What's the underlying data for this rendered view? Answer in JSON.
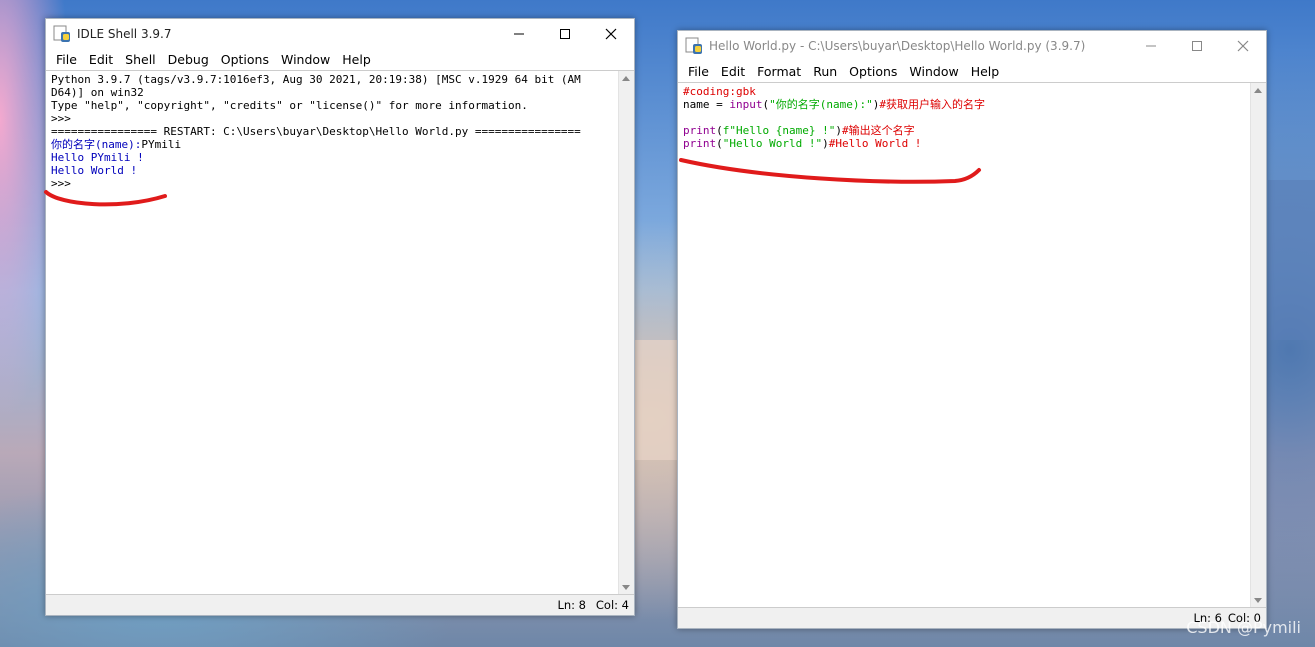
{
  "shell": {
    "title": "IDLE Shell 3.9.7",
    "menu": [
      "File",
      "Edit",
      "Shell",
      "Debug",
      "Options",
      "Window",
      "Help"
    ],
    "lines": [
      "Python 3.9.7 (tags/v3.9.7:1016ef3, Aug 30 2021, 20:19:38) [MSC v.1929 64 bit (AM",
      "D64)] on win32",
      "Type \"help\", \"copyright\", \"credits\" or \"license()\" for more information.",
      ">>>",
      "================ RESTART: C:\\Users\\buyar\\Desktop\\Hello World.py ================"
    ],
    "prompt_label": "你的名字(name):",
    "prompt_input": "PYmili",
    "output": [
      "Hello PYmili !",
      "Hello World !"
    ],
    "final_prompt": ">>>",
    "status_ln": "Ln: 8",
    "status_col": "Col: 4"
  },
  "editor": {
    "title": "Hello World.py - C:\\Users\\buyar\\Desktop\\Hello World.py (3.9.7)",
    "menu": [
      "File",
      "Edit",
      "Format",
      "Run",
      "Options",
      "Window",
      "Help"
    ],
    "line1": "#coding:gbk",
    "line2": {
      "a": "name = ",
      "b": "input",
      "c": "(",
      "d": "\"你的名字(name):\"",
      "e": ")",
      "f": "#获取用户输入的名字"
    },
    "line4": {
      "a": "print",
      "b": "(",
      "c": "f\"Hello {name} !\"",
      "d": ")",
      "e": "#输出这个名字"
    },
    "line5": {
      "a": "print",
      "b": "(",
      "c": "\"Hello World !\"",
      "d": ")",
      "e": "#Hello World !"
    },
    "status_ln": "Ln: 6",
    "status_col": "Col: 0"
  },
  "watermark": "CSDN @Pymili",
  "colors": {
    "output": "#0000bb",
    "comment": "#dd0000",
    "string": "#00aa00",
    "builtin": "#900090",
    "annotation": "#e01b1b"
  }
}
